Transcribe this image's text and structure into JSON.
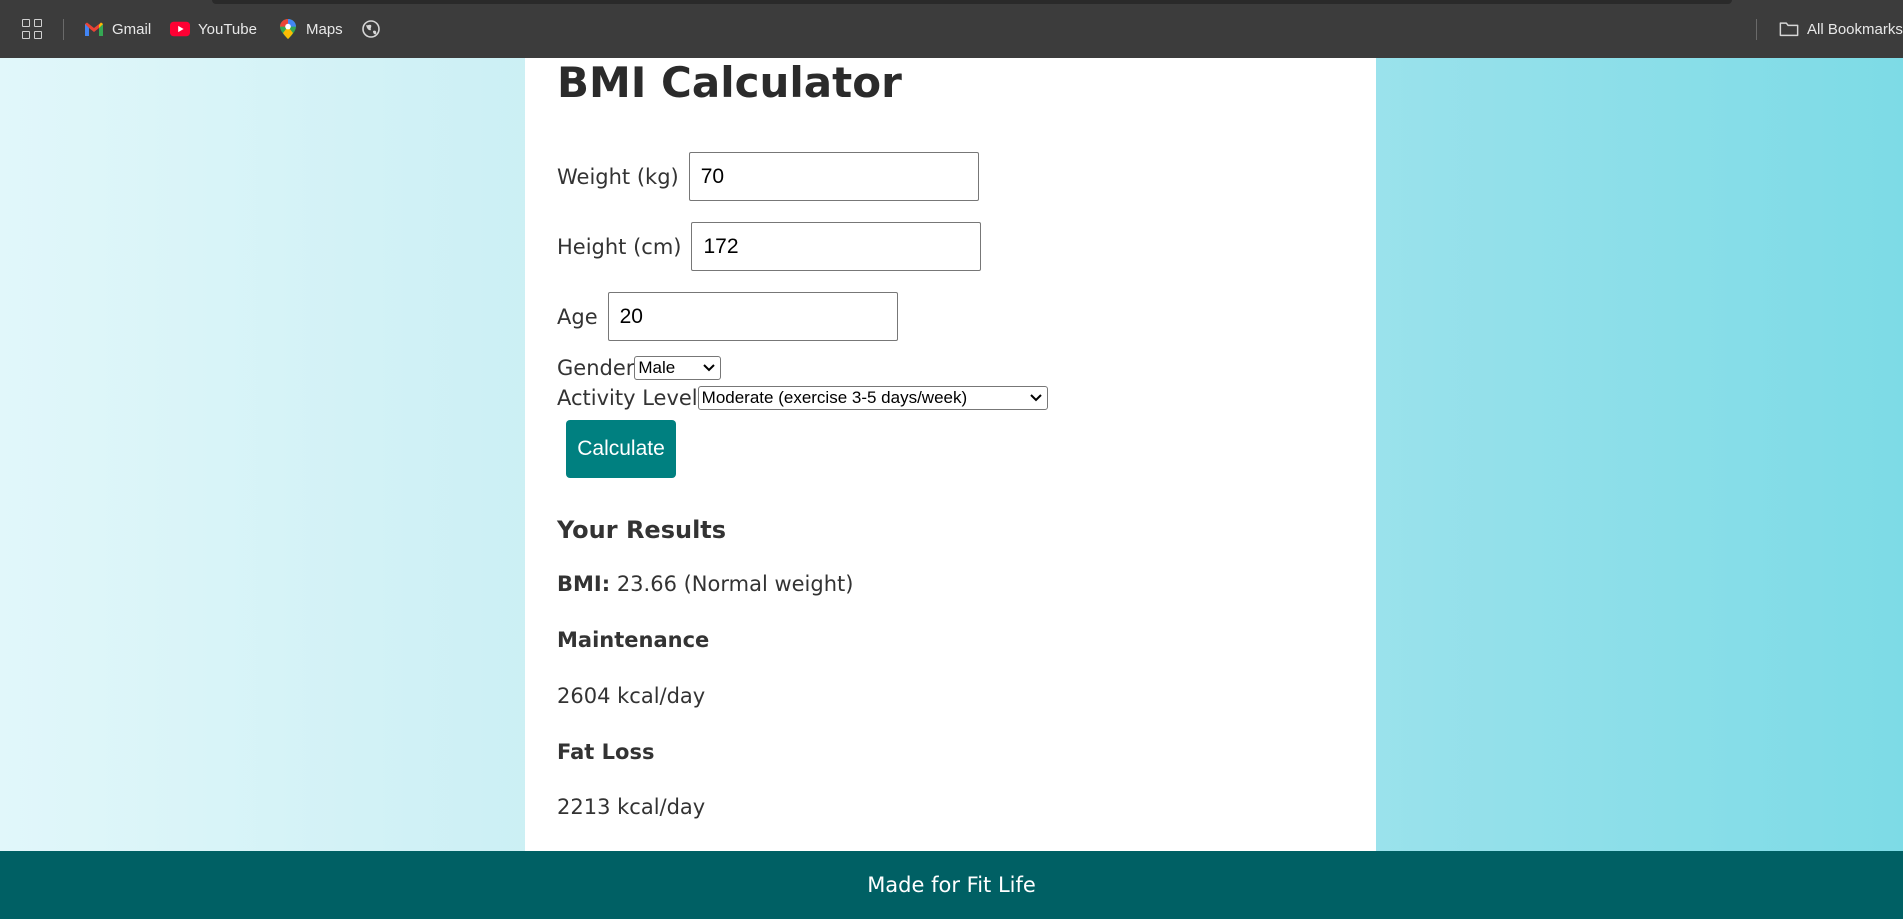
{
  "bookmarks": {
    "items": [
      {
        "label": "Gmail",
        "icon": "gmail-icon"
      },
      {
        "label": "YouTube",
        "icon": "youtube-icon"
      },
      {
        "label": "Maps",
        "icon": "maps-icon"
      }
    ],
    "all_bookmarks_label": "All Bookmarks"
  },
  "page": {
    "title": "BMI Calculator"
  },
  "form": {
    "weight_label": "Weight (kg)",
    "weight_value": "70",
    "height_label": "Height (cm)",
    "height_value": "172",
    "age_label": "Age",
    "age_value": "20",
    "gender_label": "Gender",
    "gender_value": "Male",
    "activity_label": "Activity Level",
    "activity_value": "Moderate (exercise 3-5 days/week)",
    "calculate_label": "Calculate"
  },
  "results": {
    "heading": "Your Results",
    "bmi_label": "BMI:",
    "bmi_value": "23.66 (Normal weight)",
    "maintenance_label": "Maintenance",
    "maintenance_value": "2604 kcal/day",
    "fat_loss_label": "Fat Loss",
    "fat_loss_value": "2213 kcal/day"
  },
  "footer": {
    "text": "Made for Fit Life"
  },
  "colors": {
    "accent": "#008080",
    "footer_bg": "#006064",
    "bookmarks_bar_bg": "#3c3c3c"
  }
}
